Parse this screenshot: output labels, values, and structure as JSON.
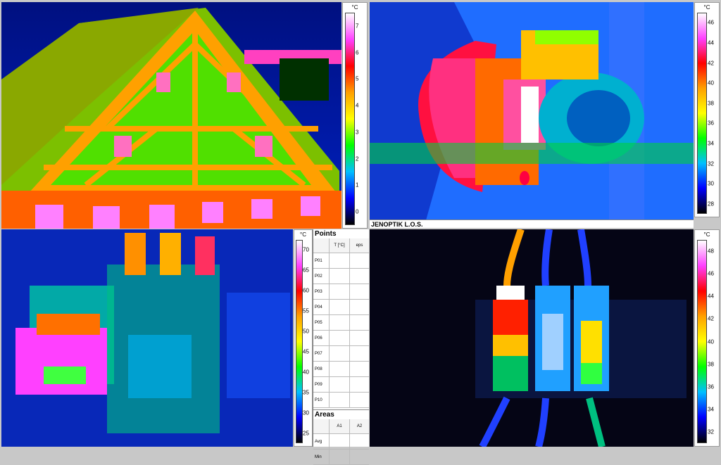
{
  "panels": {
    "house": {
      "scale": {
        "unit": "°C",
        "ticks": [
          "7",
          "6",
          "5",
          "4",
          "3",
          "2",
          "1",
          "0"
        ]
      }
    },
    "motor": {
      "scale": {
        "unit": "°C",
        "ticks": [
          "46",
          "44",
          "42",
          "40",
          "38",
          "36",
          "34",
          "32",
          "30",
          "28"
        ]
      },
      "brand": "JENOPTIK L.O.S."
    },
    "switchbox": {
      "scale": {
        "unit": "°C",
        "ticks": [
          "70",
          "65",
          "60",
          "55",
          "50",
          "45",
          "40",
          "35",
          "30",
          "25"
        ]
      }
    },
    "fuses": {
      "scale": {
        "unit": "°C",
        "ticks": [
          "48",
          "46",
          "44",
          "42",
          "40",
          "38",
          "36",
          "34",
          "32"
        ]
      }
    }
  },
  "points_table": {
    "title": "Points",
    "columns": [
      "",
      "T [°C]",
      "eps"
    ],
    "rows": [
      "P01",
      "P02",
      "P03",
      "P04",
      "P05",
      "P06",
      "P07",
      "P08",
      "P09",
      "P10"
    ]
  },
  "areas_table": {
    "title": "Areas",
    "columns": [
      "",
      "A1",
      "A2"
    ],
    "rows": [
      "Avg",
      "Min"
    ]
  },
  "colors": {
    "cold": "#000060",
    "cool": "#0040ff",
    "mid": "#00e000",
    "warm": "#ffd000",
    "hot": "#ff2000",
    "hottest": "#ffffff"
  }
}
